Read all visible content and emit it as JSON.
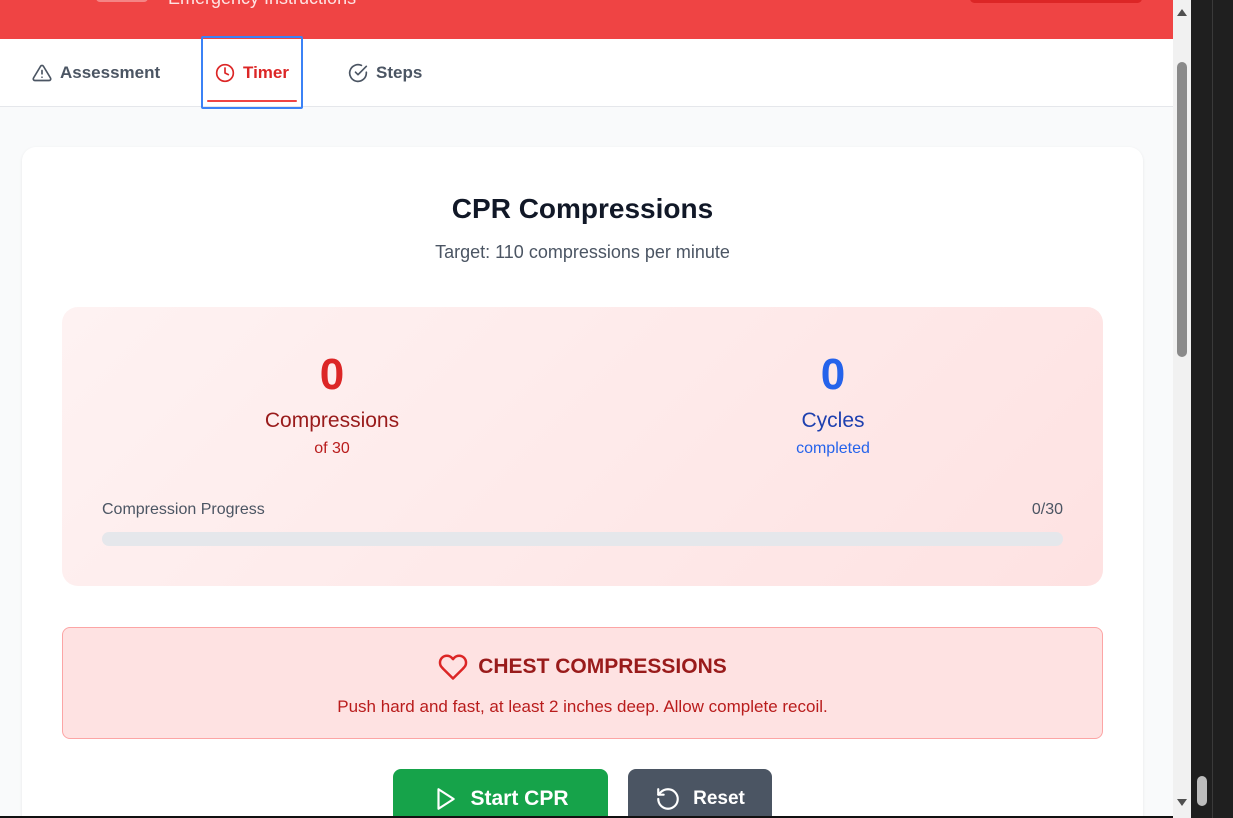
{
  "header": {
    "title": "Emergency Instructions"
  },
  "tabs": [
    {
      "label": "Assessment",
      "icon": "alert-triangle-icon"
    },
    {
      "label": "Timer",
      "icon": "clock-icon",
      "active": true
    },
    {
      "label": "Steps",
      "icon": "check-circle-icon"
    }
  ],
  "card": {
    "title": "CPR Compressions",
    "subtitle": "Target: 110 compressions per minute"
  },
  "stats": {
    "compressions": {
      "value": "0",
      "label": "Compressions",
      "sub": "of 30"
    },
    "cycles": {
      "value": "0",
      "label": "Cycles",
      "sub": "completed"
    }
  },
  "progress": {
    "label": "Compression Progress",
    "count": "0/30",
    "fraction": 0
  },
  "instruction": {
    "icon": "heart-icon",
    "heading": "CHEST COMPRESSIONS",
    "text": "Push hard and fast, at least 2 inches deep. Allow complete recoil."
  },
  "buttons": {
    "start_label": "Start CPR",
    "reset_label": "Reset"
  },
  "colors": {
    "header": "#ef4444",
    "accent_red": "#dc2626",
    "accent_blue": "#2563eb",
    "start_green": "#16a34a",
    "reset_gray": "#4b5563",
    "focus_ring": "#3b82f6"
  }
}
